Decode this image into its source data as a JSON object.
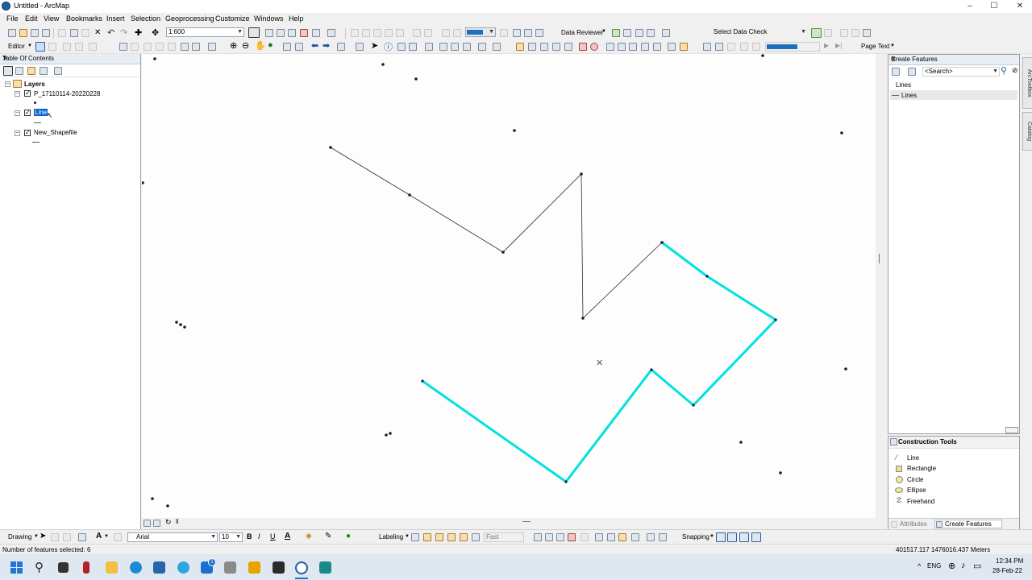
{
  "window": {
    "title": "Untitled - ArcMap",
    "min": "–",
    "max": "☐",
    "close": "✕"
  },
  "menu": [
    "File",
    "Edit",
    "View",
    "Bookmarks",
    "Insert",
    "Selection",
    "Geoprocessing",
    "Customize",
    "Windows",
    "Help"
  ],
  "toolbar": {
    "scale": "1:600",
    "data_reviewer": "Data Reviewer",
    "select_data_check": "Select Data Check",
    "editor": "Editor",
    "page_text": "Page Text"
  },
  "toc": {
    "title": "Table Of Contents",
    "root": "Layers",
    "layers": [
      "P_17110114-20220228",
      "Line",
      "New_Shapefile"
    ]
  },
  "create_features": {
    "title": "Create Features",
    "search_placeholder": "<Search>",
    "group": "Lines",
    "template": "Lines"
  },
  "construction_tools": {
    "title": "Construction Tools",
    "tools": [
      "Line",
      "Rectangle",
      "Circle",
      "Ellipse",
      "Freehand"
    ]
  },
  "panel_tabs": {
    "attributes": "Attributes",
    "create_features": "Create Features"
  },
  "side_tabs": [
    "ArcToolbox",
    "Catalog"
  ],
  "drawing": {
    "drawing_label": "Drawing",
    "font": "Arial",
    "font_size": "10",
    "bold": "B",
    "italic": "I",
    "underline": "U",
    "labeling": "Labeling",
    "fast": "Fast",
    "snapping": "Snapping"
  },
  "status": {
    "selected": "Number of features selected: 6",
    "coords": "401517.117  1476016.437 Meters"
  },
  "taskbar": {
    "lang": "ENG",
    "time": "12:34 PM",
    "date": "28-Feb-22"
  },
  "colors": {
    "selection": "#00e1e1",
    "line": "#3d2233",
    "vertex": "#1a1a33"
  }
}
